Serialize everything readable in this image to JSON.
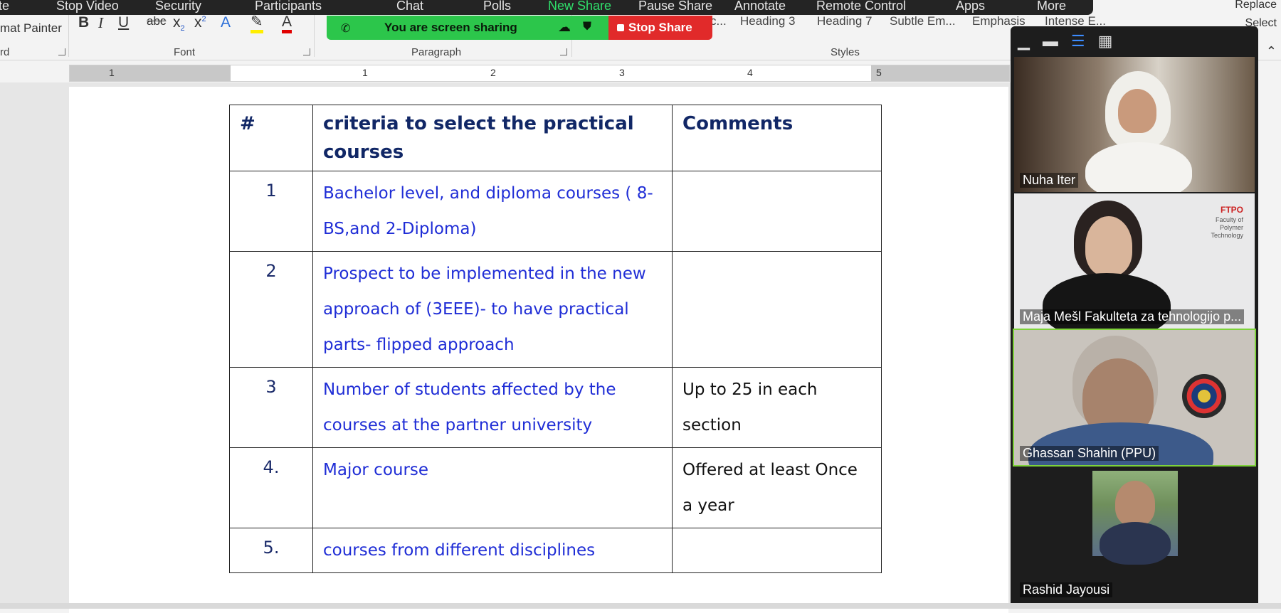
{
  "zoom_toolbar": {
    "items": [
      "te",
      "Stop Video",
      "Security",
      "Participants",
      "Polls",
      "Chat",
      "New Share",
      "Pause Share",
      "Annotate",
      "Remote Control",
      "Apps",
      "More"
    ]
  },
  "share_banner": {
    "message": "You are screen sharing",
    "stop_label": "Stop Share"
  },
  "ribbon": {
    "clipboard_partial": "mat Painter",
    "clipboard_label_partial": "rd",
    "font_group": "Font",
    "paragraph_group": "Paragraph",
    "styles_group": "Styles",
    "styles": [
      "c...",
      "Heading 3",
      "Heading 7",
      "Subtle Em...",
      "Emphasis",
      "Intense E..."
    ],
    "replace_label": "Replace",
    "select_label": "Select"
  },
  "ruler": {
    "numbers": [
      "1",
      "1",
      "1",
      "2",
      "3",
      "4",
      "5"
    ]
  },
  "table": {
    "headers": [
      "#",
      "criteria to select the practical courses",
      "Comments"
    ],
    "rows": [
      {
        "num": "1",
        "criteria": " Bachelor level, and diploma courses ( 8-BS,and 2-Diploma)",
        "comment": ""
      },
      {
        "num": "2",
        "criteria": "Prospect to be implemented in the new approach of  (3EEE)- to have practical parts- flipped approach",
        "comment": ""
      },
      {
        "num": "3",
        "criteria": "Number of students  affected by the courses  at the partner university",
        "comment": "Up to 25 in each section"
      },
      {
        "num": "4.",
        "criteria": "Major course",
        "comment": "Offered at least Once a year"
      },
      {
        "num": "5.",
        "criteria": "courses from different disciplines",
        "comment": ""
      }
    ]
  },
  "participants": [
    {
      "name": "Nuha Iter"
    },
    {
      "name": "Maja Mešl Fakulteta za tehnologijo p..."
    },
    {
      "name": "Ghassan Shahin (PPU)"
    },
    {
      "name": "Rashid Jayousi"
    }
  ],
  "tile_logo": {
    "brand": "FTPO",
    "lines": [
      "Faculty of",
      "Polymer",
      "Technology"
    ]
  }
}
